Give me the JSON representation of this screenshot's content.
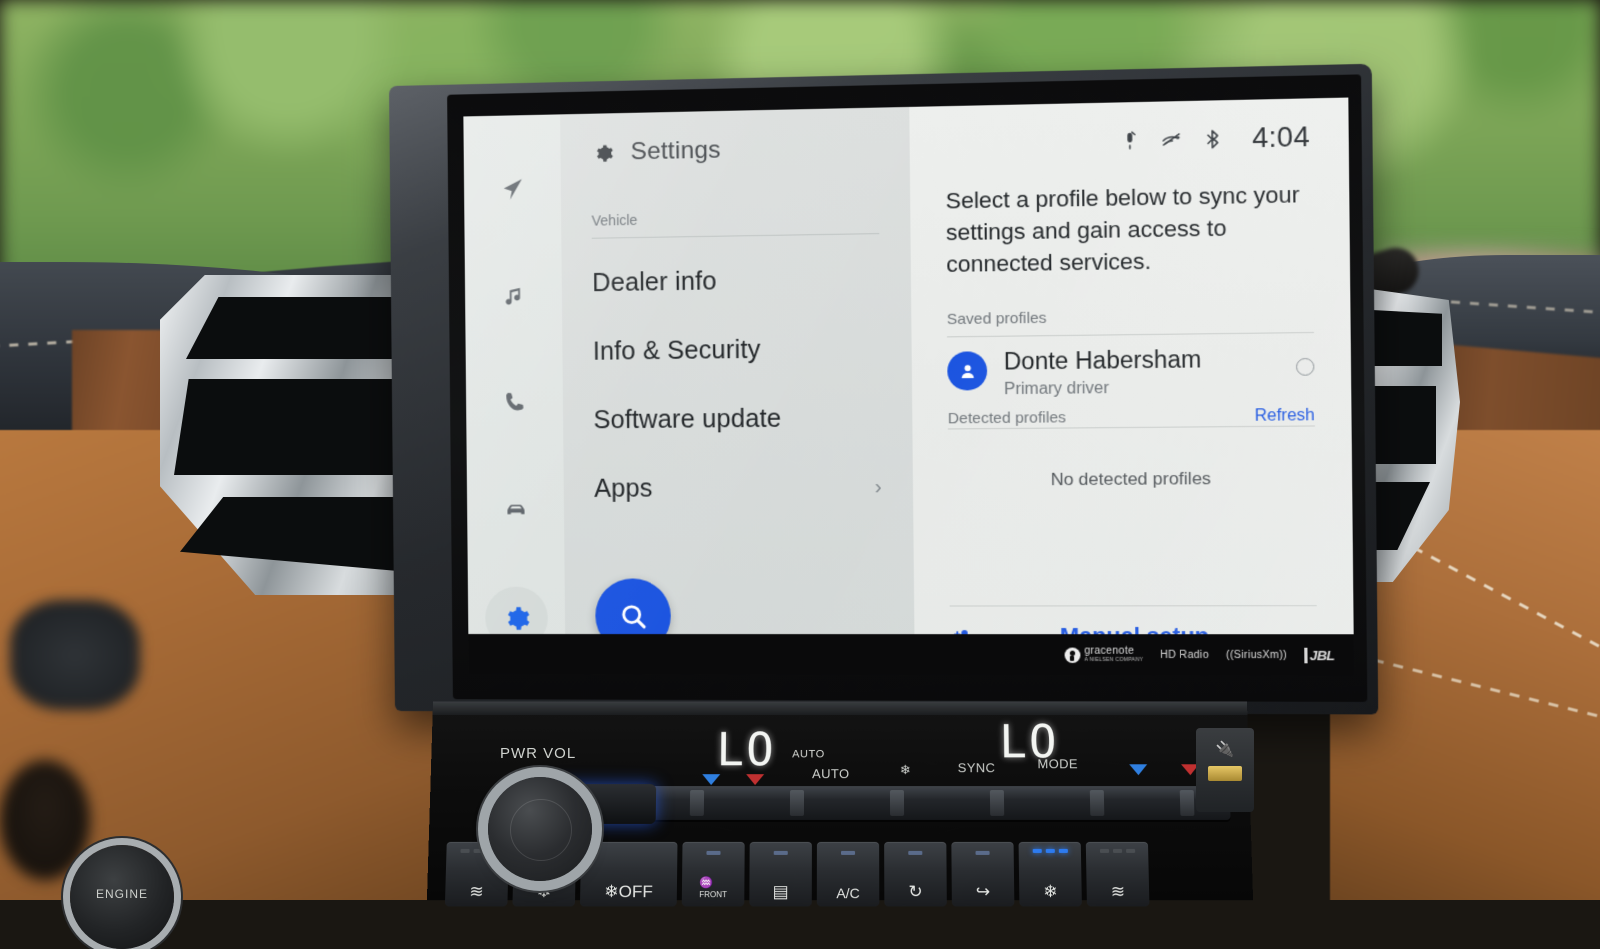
{
  "screen": {
    "app_title": "Settings",
    "rail": [
      {
        "name": "navigation",
        "icon": "navigation-arrow-icon",
        "active": false
      },
      {
        "name": "media",
        "icon": "music-note-icon",
        "active": false
      },
      {
        "name": "phone",
        "icon": "phone-icon",
        "active": false
      },
      {
        "name": "vehicle",
        "icon": "car-icon",
        "active": false
      },
      {
        "name": "settings",
        "icon": "gear-icon",
        "active": true
      }
    ],
    "menu": {
      "section_label": "Vehicle",
      "items": [
        {
          "label": "Dealer info",
          "chevron": ""
        },
        {
          "label": "Info & Security",
          "chevron": ""
        },
        {
          "label": "Software update",
          "chevron": ""
        },
        {
          "label": "Apps",
          "chevron": "›"
        }
      ],
      "search_icon": "search-icon"
    },
    "status": {
      "icons": [
        "mic-muted-icon",
        "driver-attention-off-icon",
        "bluetooth-icon"
      ],
      "clock": "4:04"
    },
    "profiles": {
      "intro": "Select a profile below to sync your settings and gain access to connected services.",
      "saved_label": "Saved profiles",
      "saved": [
        {
          "name": "Donte Habersham",
          "role": "Primary driver",
          "selected": false
        }
      ],
      "detected_label": "Detected profiles",
      "refresh_label": "Refresh",
      "detected_empty": "No detected profiles",
      "add_icon": "add-person-icon",
      "manual_setup_label": "Manual setup"
    },
    "brands": [
      {
        "name": "gracenote",
        "sub": "A NIELSEN COMPANY"
      },
      {
        "name": "HD Radio",
        "sub": ""
      },
      {
        "name": "((SiriusXm))",
        "sub": ""
      },
      {
        "name": "JBL",
        "sub": ""
      }
    ],
    "colors": {
      "accent_blue": "#1a53e0",
      "panel_light": "#edefed",
      "panel_mid": "#dcdfde",
      "rail": "#e4e8e6",
      "text_primary": "#1e2225",
      "text_muted": "#70767b"
    }
  },
  "climate": {
    "temp_left": "LO",
    "temp_right": "LO",
    "auto_indicator": "AUTO",
    "labels": [
      "AUTO",
      "SYNC",
      "MODE"
    ],
    "fan_icon": "fan-icon",
    "buttons": [
      {
        "glyph": "≋",
        "label": "",
        "name": "seat-heater-left",
        "leds": 3,
        "leds_on": 0
      },
      {
        "glyph": "❄",
        "label": "",
        "name": "seat-cooler-left",
        "leds": 3,
        "leds_on": 3
      },
      {
        "glyph": "❄",
        "label": "OFF",
        "name": "fan-off",
        "leds": 0,
        "leds_on": 0
      },
      {
        "glyph": "♒",
        "label": "FRONT",
        "name": "front-defrost",
        "leds": 1,
        "leds_on": 0
      },
      {
        "glyph": "▤",
        "label": "",
        "name": "rear-defrost",
        "leds": 1,
        "leds_on": 0
      },
      {
        "glyph": "A/C",
        "label": "",
        "name": "ac-button",
        "leds": 1,
        "leds_on": 0
      },
      {
        "glyph": "↻",
        "label": "",
        "name": "recirculate-air",
        "leds": 1,
        "leds_on": 0
      },
      {
        "glyph": "↪",
        "label": "",
        "name": "fresh-air",
        "leds": 1,
        "leds_on": 0
      },
      {
        "glyph": "❄",
        "label": "",
        "name": "seat-cooler-right",
        "leds": 3,
        "leds_on": 3
      },
      {
        "glyph": "≋",
        "label": "",
        "name": "seat-heater-right",
        "leds": 3,
        "leds_on": 0
      }
    ]
  },
  "console": {
    "pwr_vol_label": "PWR VOL",
    "engine_label": "ENGINE",
    "usb_icon": "usb-icon"
  }
}
